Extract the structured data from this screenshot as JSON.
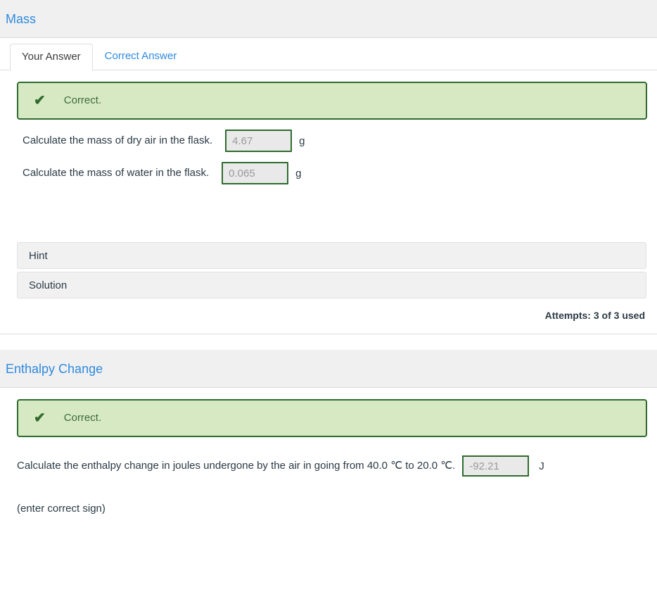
{
  "sections": [
    {
      "title": "Mass",
      "tabs": [
        {
          "label": "Your Answer",
          "active": true
        },
        {
          "label": "Correct Answer",
          "active": false
        }
      ],
      "alert": {
        "icon": "check-icon",
        "glyph": "✔",
        "text": "Correct.",
        "bg_color": "#d7e9c3",
        "border_color": "#2f6b2f",
        "text_color": "#3d6b3d"
      },
      "questions": [
        {
          "label": "Calculate the mass of dry air in the flask.",
          "value": "4.67",
          "unit": "g"
        },
        {
          "label": "Calculate the mass of water in the flask.",
          "value": "0.065",
          "unit": "g"
        }
      ],
      "panels": [
        {
          "label": "Hint"
        },
        {
          "label": "Solution"
        }
      ],
      "attempts": "Attempts: 3 of 3 used"
    },
    {
      "title": "Enthalpy Change",
      "alert": {
        "icon": "check-icon",
        "glyph": "✔",
        "text": "Correct.",
        "bg_color": "#d7e9c3",
        "border_color": "#2f6b2f",
        "text_color": "#3d6b3d"
      },
      "question": {
        "label": "Calculate the enthalpy change in joules undergone by the air in going from 40.0 ℃ to 20.0 ℃.",
        "value": "-92.21",
        "unit": "J"
      },
      "note": "(enter correct sign)"
    }
  ],
  "colors": {
    "link_blue": "#2f8ae0",
    "header_band": "#f0f0f0",
    "success_border": "#2f6b2f",
    "success_bg": "#d7e9c3",
    "body_text": "#2b3a45"
  }
}
